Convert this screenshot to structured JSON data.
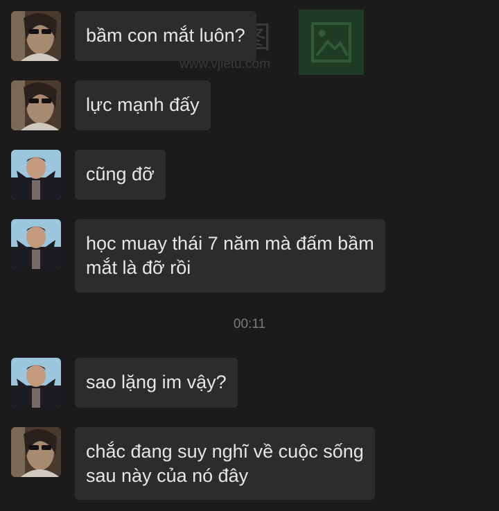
{
  "watermark": {
    "brand": "微截图",
    "url": "www.vjietu.com"
  },
  "timestamp": "00:11",
  "messages": [
    {
      "sender": "friend_a",
      "text": "bầm con mắt luôn?"
    },
    {
      "sender": "friend_a",
      "text": "lực mạnh đấy"
    },
    {
      "sender": "friend_b",
      "text": "cũng đỡ"
    },
    {
      "sender": "friend_b",
      "text": "học muay thái 7 năm mà đấm bầm\nmắt là đỡ rồi"
    },
    {
      "sender": "friend_b",
      "text": "sao lặng im vậy?"
    },
    {
      "sender": "friend_a",
      "text": "chắc đang suy nghĩ về cuộc sống\nsau này của nó đây"
    }
  ],
  "colors": {
    "background": "#1b1b1c",
    "bubble": "#2c2c2d",
    "text": "#e6e6e6",
    "timestamp": "#7a7a7a"
  }
}
